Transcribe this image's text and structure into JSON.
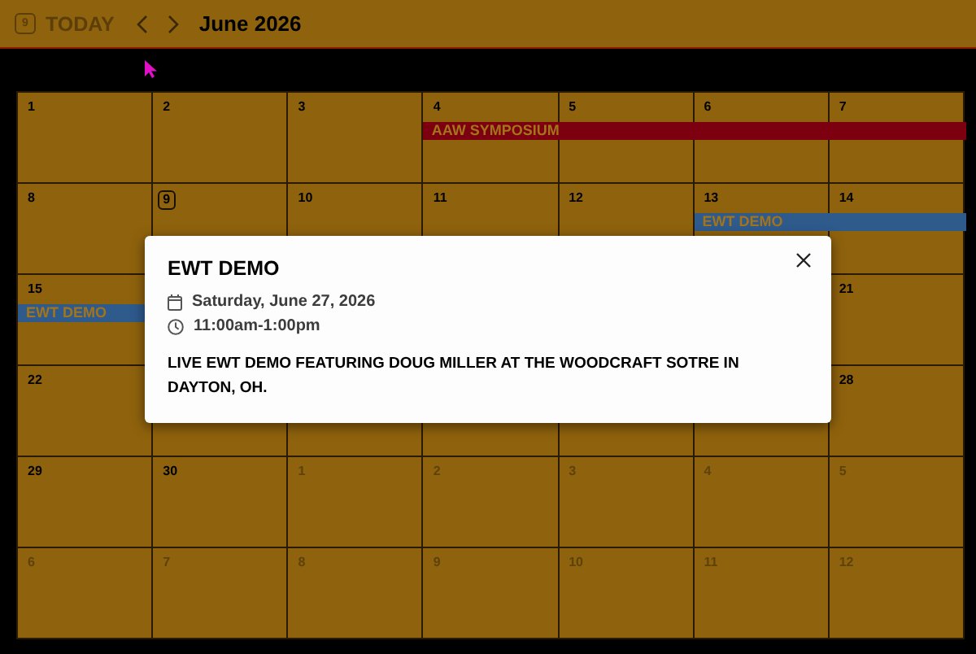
{
  "header": {
    "today_badge": "9",
    "today_label": "TODAY",
    "title": "June 2026"
  },
  "weeks": [
    {
      "days": [
        {
          "label": "1",
          "outside": false,
          "today": false
        },
        {
          "label": "2",
          "outside": false,
          "today": false
        },
        {
          "label": "3",
          "outside": false,
          "today": false
        },
        {
          "label": "4",
          "outside": false,
          "today": false,
          "event": {
            "kind": "start",
            "title": "AAW SYMPOSIUM",
            "color": "#7d0010"
          }
        },
        {
          "label": "5",
          "outside": false,
          "today": false,
          "event": {
            "kind": "continue"
          }
        },
        {
          "label": "6",
          "outside": false,
          "today": false,
          "event": {
            "kind": "continue"
          }
        },
        {
          "label": "7",
          "outside": false,
          "today": false,
          "event": {
            "kind": "continue"
          }
        }
      ]
    },
    {
      "days": [
        {
          "label": "8",
          "outside": false,
          "today": false
        },
        {
          "label": "9",
          "outside": false,
          "today": true
        },
        {
          "label": "10",
          "outside": false,
          "today": false
        },
        {
          "label": "11",
          "outside": false,
          "today": false
        },
        {
          "label": "12",
          "outside": false,
          "today": false
        },
        {
          "label": "13",
          "outside": false,
          "today": false,
          "event": {
            "kind": "start",
            "title": "EWT DEMO",
            "color": "#2e5a8c"
          }
        },
        {
          "label": "14",
          "outside": false,
          "today": false,
          "event": {
            "kind": "continue"
          }
        }
      ]
    },
    {
      "left_days": [
        {
          "label": "15",
          "outside": false,
          "today": false,
          "event": {
            "kind": "start",
            "title": "EWT DEMO",
            "color": "#2e5a8c"
          }
        }
      ],
      "right_days": [
        {
          "label": "21",
          "outside": false,
          "today": false
        }
      ]
    },
    {
      "left_days": [
        {
          "label": "22",
          "outside": false,
          "today": false
        }
      ],
      "right_days": [
        {
          "label": "28",
          "outside": false,
          "today": false
        }
      ]
    },
    {
      "days": [
        {
          "label": "29",
          "outside": false,
          "today": false
        },
        {
          "label": "30",
          "outside": false,
          "today": false
        },
        {
          "label": "1",
          "outside": true,
          "today": false
        },
        {
          "label": "2",
          "outside": true,
          "today": false
        },
        {
          "label": "3",
          "outside": true,
          "today": false
        },
        {
          "label": "4",
          "outside": true,
          "today": false
        },
        {
          "label": "5",
          "outside": true,
          "today": false
        }
      ]
    },
    {
      "days": [
        {
          "label": "6",
          "outside": true,
          "today": false
        },
        {
          "label": "7",
          "outside": true,
          "today": false
        },
        {
          "label": "8",
          "outside": true,
          "today": false
        },
        {
          "label": "9",
          "outside": true,
          "today": false
        },
        {
          "label": "10",
          "outside": true,
          "today": false
        },
        {
          "label": "11",
          "outside": true,
          "today": false
        },
        {
          "label": "12",
          "outside": true,
          "today": false
        }
      ]
    }
  ],
  "popup": {
    "title": "EWT DEMO",
    "date": "Saturday, June 27, 2026",
    "time": "11:00am-1:00pm",
    "description": "LIVE EWT DEMO FEATURING DOUG MILLER AT THE WOODCRAFT SOTRE IN DAYTON, OH."
  }
}
